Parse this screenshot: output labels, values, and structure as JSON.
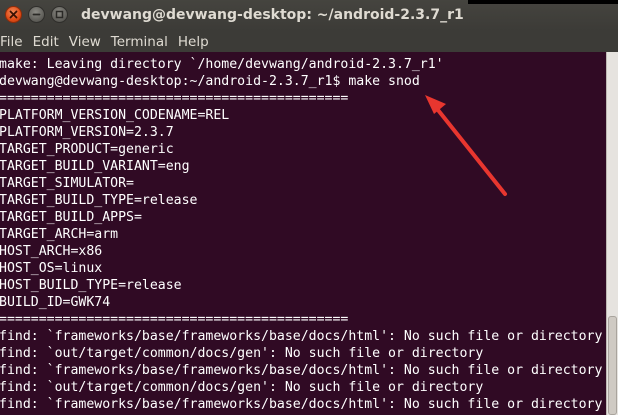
{
  "window": {
    "title": "devwang@devwang-desktop: ~/android-2.3.7_r1"
  },
  "menu": {
    "items": [
      "File",
      "Edit",
      "View",
      "Terminal",
      "Help"
    ]
  },
  "terminal": {
    "lines": [
      "make: Leaving directory `/home/devwang/android-2.3.7_r1'",
      "devwang@devwang-desktop:~/android-2.3.7_r1$ make snod",
      "============================================",
      "PLATFORM_VERSION_CODENAME=REL",
      "PLATFORM_VERSION=2.3.7",
      "TARGET_PRODUCT=generic",
      "TARGET_BUILD_VARIANT=eng",
      "TARGET_SIMULATOR=",
      "TARGET_BUILD_TYPE=release",
      "TARGET_BUILD_APPS=",
      "TARGET_ARCH=arm",
      "HOST_ARCH=x86",
      "HOST_OS=linux",
      "HOST_BUILD_TYPE=release",
      "BUILD_ID=GWK74",
      "============================================",
      "find: `frameworks/base/frameworks/base/docs/html': No such file or directory",
      "find: `out/target/common/docs/gen': No such file or directory",
      "find: `frameworks/base/frameworks/base/docs/html': No such file or directory",
      "find: `out/target/common/docs/gen': No such file or directory",
      "find: `frameworks/base/frameworks/base/docs/html': No such file or directory"
    ]
  },
  "annotation": {
    "arrow_color": "#e8362f"
  }
}
